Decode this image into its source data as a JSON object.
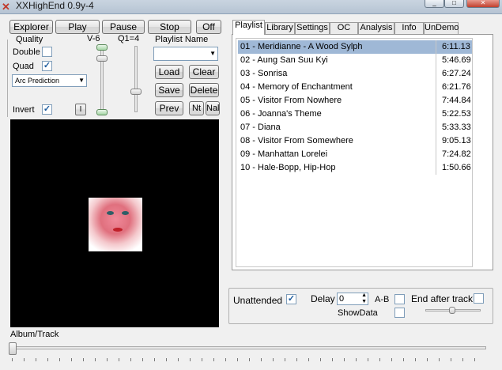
{
  "window": {
    "title": "XXHighEnd 0.9y-4"
  },
  "toolbar": {
    "explorer": "Explorer",
    "play": "Play",
    "pause": "Pause",
    "stop": "Stop",
    "off": "Off"
  },
  "quality": {
    "title": "Quality",
    "v_label": "V-6",
    "q_label": "Q1=4",
    "double": "Double",
    "quad": "Quad",
    "prediction": "Arc Prediction",
    "invert": "Invert",
    "i_button": "I"
  },
  "playlist_controls": {
    "name_label": "Playlist Name",
    "load": "Load",
    "clear": "Clear",
    "save": "Save",
    "delete": "Delete",
    "prev": "Prev",
    "nt": "Nt",
    "nal": "Nal"
  },
  "tabs": [
    "Playlist",
    "Library",
    "Settings",
    "OC",
    "Analysis",
    "Info",
    "UnDemo"
  ],
  "playlist": [
    {
      "name": "01 - Meridianne - A Wood Sylph",
      "time": "6:11.13"
    },
    {
      "name": "02 - Aung San Suu Kyi",
      "time": "5:46.69"
    },
    {
      "name": "03 - Sonrisa",
      "time": "6:27.24"
    },
    {
      "name": "04 - Memory of Enchantment",
      "time": "6:21.76"
    },
    {
      "name": "05 - Visitor From Nowhere",
      "time": "7:44.84"
    },
    {
      "name": "06 - Joanna's Theme",
      "time": "5:22.53"
    },
    {
      "name": "07 - Diana",
      "time": "5:33.33"
    },
    {
      "name": "08 - Visitor From Somewhere",
      "time": "9:05.13"
    },
    {
      "name": "09 - Manhattan Lorelei",
      "time": "7:24.82"
    },
    {
      "name": "10 - Hale-Bopp, Hip-Hop",
      "time": "1:50.66"
    }
  ],
  "options": {
    "unattended": "Unattended",
    "delay": "Delay",
    "delay_value": "0",
    "ab": "A-B",
    "end_after_track": "End after track",
    "showdata": "ShowData"
  },
  "footer": {
    "album_track": "Album/Track"
  },
  "colors": {
    "selection": "#9fb8d6",
    "video_bg": "#000000",
    "check": "#1d5c9e"
  }
}
